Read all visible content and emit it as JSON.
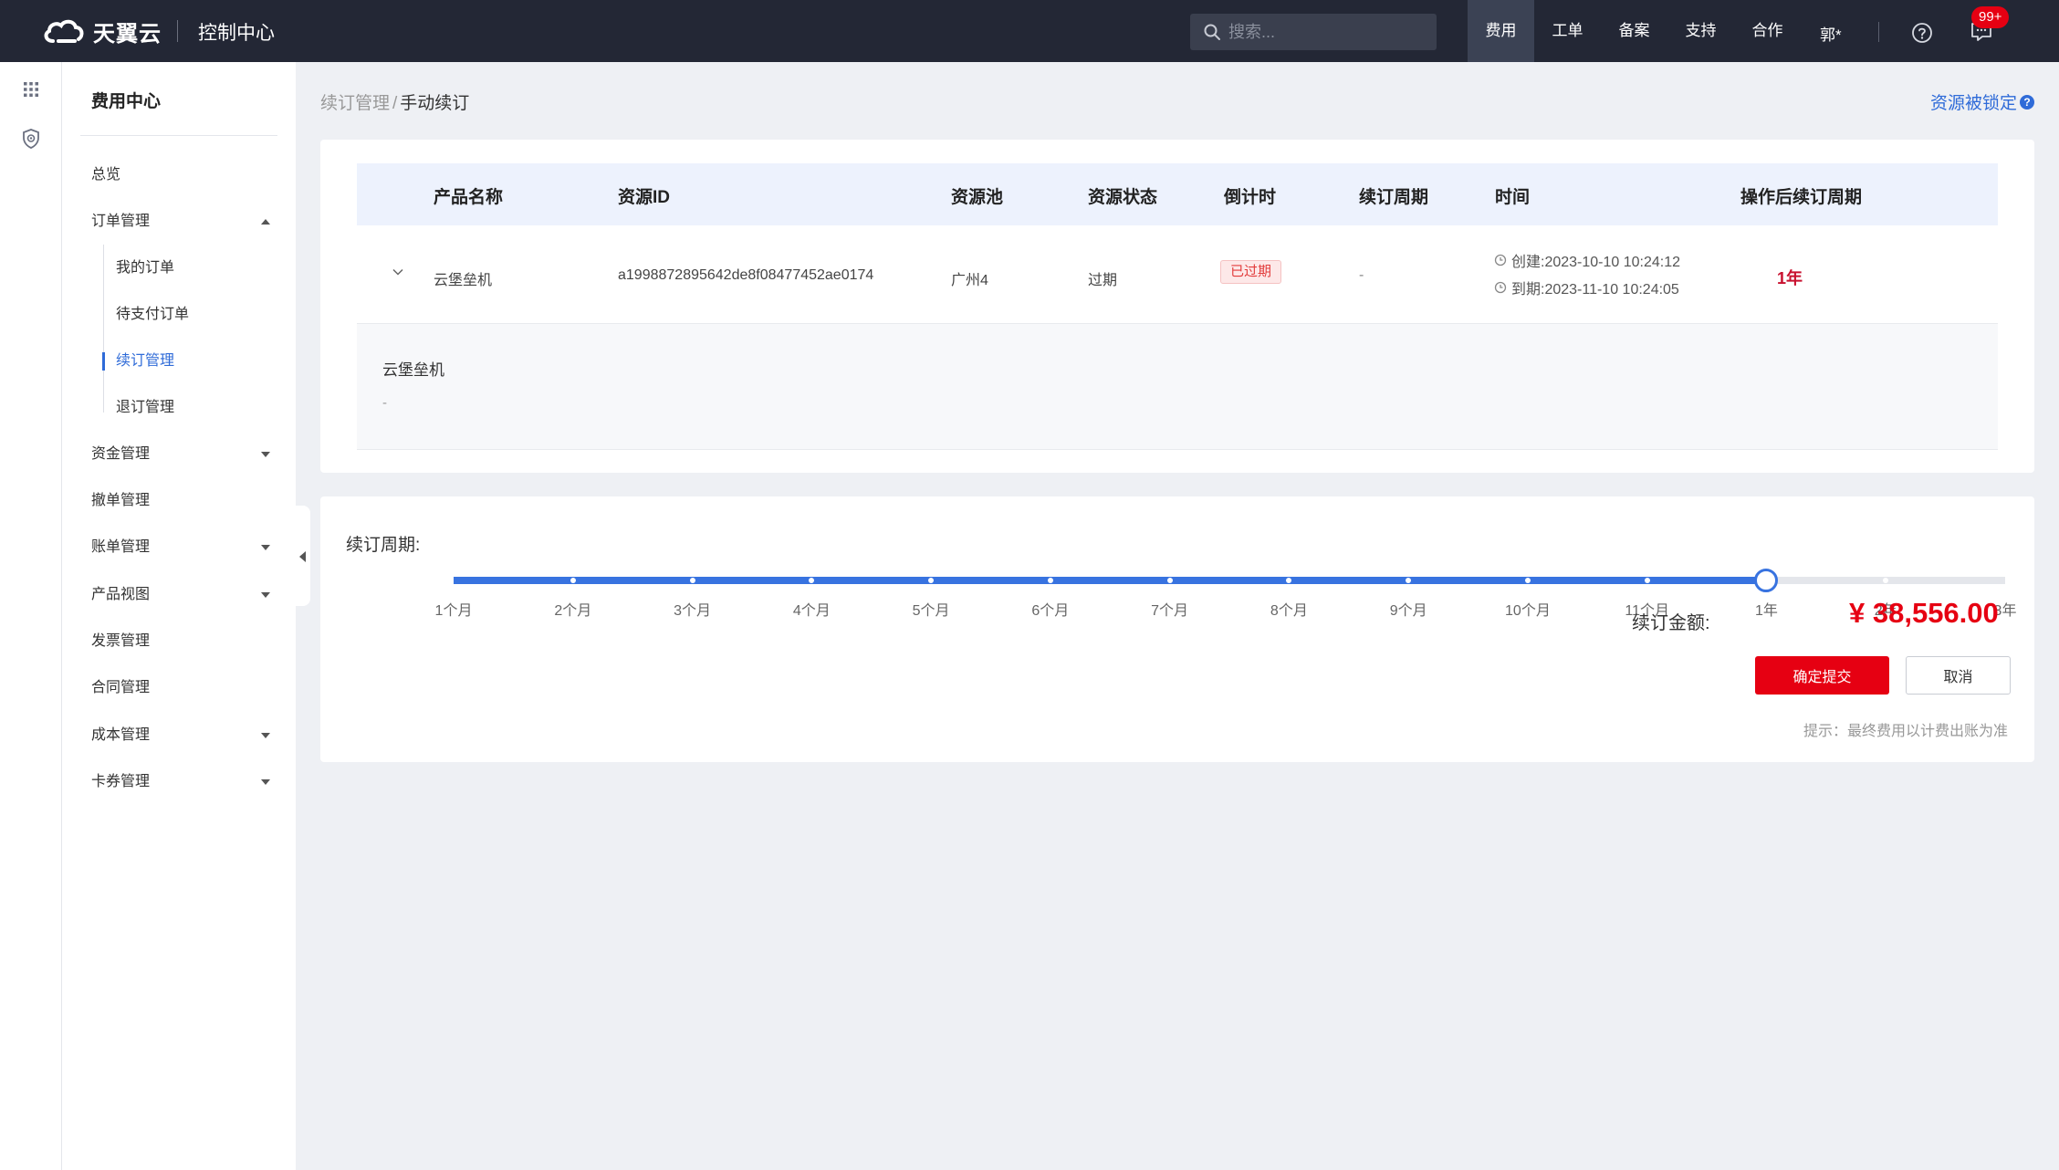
{
  "header": {
    "brand": "天翼云",
    "console_title": "控制中心",
    "search_placeholder": "搜索...",
    "nav": [
      {
        "label": "费用",
        "active": true
      },
      {
        "label": "工单",
        "active": false
      },
      {
        "label": "备案",
        "active": false
      },
      {
        "label": "支持",
        "active": false
      },
      {
        "label": "合作",
        "active": false
      }
    ],
    "user": "郭*",
    "message_badge": "99+"
  },
  "rail": {
    "icons": [
      "grid-icon",
      "shield-icon"
    ]
  },
  "sidebar": {
    "title": "费用中心",
    "items": [
      {
        "label": "总览"
      },
      {
        "label": "订单管理",
        "expanded": true
      },
      {
        "label": "资金管理"
      },
      {
        "label": "撤单管理"
      },
      {
        "label": "账单管理"
      },
      {
        "label": "产品视图"
      },
      {
        "label": "发票管理"
      },
      {
        "label": "合同管理"
      },
      {
        "label": "成本管理"
      },
      {
        "label": "卡券管理"
      }
    ],
    "sub_items": [
      {
        "label": "我的订单"
      },
      {
        "label": "待支付订单"
      },
      {
        "label": "续订管理",
        "active": true
      },
      {
        "label": "退订管理"
      }
    ]
  },
  "breadcrumb": {
    "parent": "续订管理",
    "separator": "/",
    "current": "手动续订"
  },
  "locked_link": "资源被锁定",
  "table": {
    "headers": [
      "产品名称",
      "资源ID",
      "资源池",
      "资源状态",
      "倒计时",
      "续订周期",
      "时间",
      "操作后续订周期"
    ],
    "row": {
      "product": "云堡垒机",
      "resource_id": "a1998872895642de8f08477452ae0174",
      "pool": "广州4",
      "status": "过期",
      "countdown": "已过期",
      "renew_period": "-",
      "created": "创建:2023-10-10 10:24:12",
      "expires": "到期:2023-11-10 10:24:05",
      "period_after": "1年"
    },
    "detail": {
      "title": "云堡垒机",
      "value": "-"
    }
  },
  "renewal": {
    "label": "续订周期:",
    "options": [
      "1个月",
      "2个月",
      "3个月",
      "4个月",
      "5个月",
      "6个月",
      "7个月",
      "8个月",
      "9个月",
      "10个月",
      "11个月",
      "1年",
      "2年",
      "3年"
    ],
    "selected_index": 11,
    "amount_label": "续订金额:",
    "amount": "¥ 38,556.00",
    "submit_label": "确定提交",
    "cancel_label": "取消",
    "hint": "提示：最终费用以计费出账为准"
  },
  "colors": {
    "topbar": "#232735",
    "accent": "#e60012",
    "link": "#2f6bd8",
    "slider": "#3873e0"
  }
}
